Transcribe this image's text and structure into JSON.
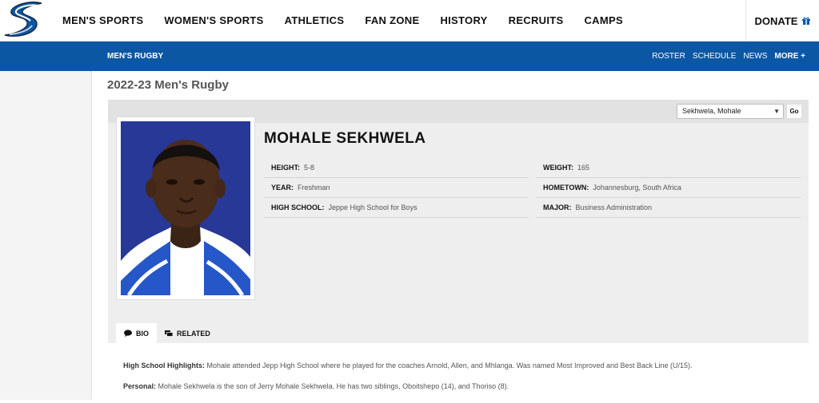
{
  "nav": {
    "menu": [
      "MEN'S SPORTS",
      "WOMEN'S SPORTS",
      "ATHLETICS",
      "FAN ZONE",
      "HISTORY",
      "RECRUITS",
      "CAMPS"
    ],
    "donate": "DONATE"
  },
  "subnav": {
    "sport": "MEN'S RUGBY",
    "links": [
      "ROSTER",
      "SCHEDULE",
      "NEWS"
    ],
    "more": "MORE +"
  },
  "page": {
    "season_title": "2022-23 Men's Rugby"
  },
  "roster_select": {
    "selected": "Sekhwela, Mohale",
    "go_label": "Go"
  },
  "player": {
    "name": "MOHALE SEKHWELA",
    "facts": [
      {
        "label": "HEIGHT:",
        "value": "5-8"
      },
      {
        "label": "WEIGHT:",
        "value": "165"
      },
      {
        "label": "YEAR:",
        "value": "Freshman"
      },
      {
        "label": "HOMETOWN:",
        "value": "Johannesburg, South Africa"
      },
      {
        "label": "HIGH SCHOOL:",
        "value": "Jeppe High School for Boys"
      },
      {
        "label": "MAJOR:",
        "value": "Business Administration"
      }
    ]
  },
  "tabs": [
    {
      "label": "BIO",
      "icon": "speech-bubble-icon",
      "active": true
    },
    {
      "label": "RELATED",
      "icon": "stacked-cards-icon",
      "active": false
    }
  ],
  "bio": {
    "highlights_label": "High School Highlights:",
    "highlights_text": " Mohale attended Jepp High School where he played for the coaches Arnold, Allen, and Mhlanga. Was named Most Improved and Best Back Line (U/15).",
    "personal_label": "Personal:",
    "personal_text": " Mohale Sekhwela is the son of Jerry Mohale Sekhwela. He has two siblings, Oboitshepo (14), and Thoriso (8)."
  },
  "colors": {
    "brand_blue": "#0b57a4",
    "panel_gray": "#eeeeee"
  }
}
